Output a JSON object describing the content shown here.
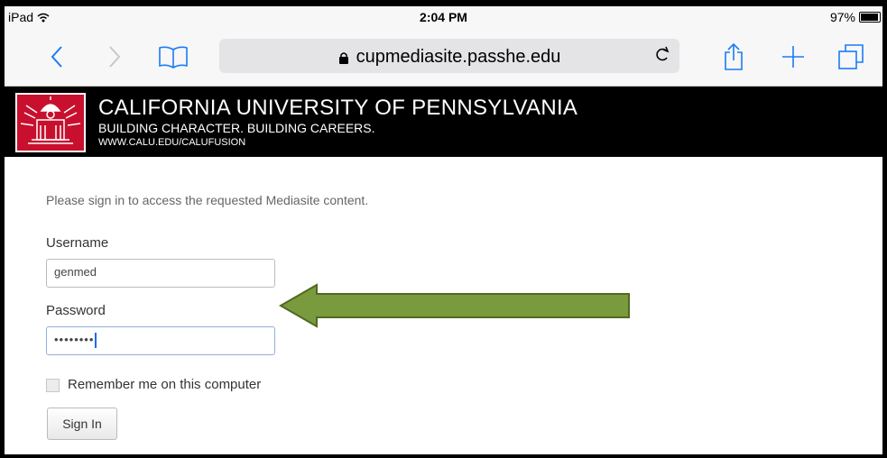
{
  "status_bar": {
    "device": "iPad",
    "time": "2:04 PM",
    "battery": "97%",
    "battery_level": 0.97
  },
  "browser": {
    "url": "cupmediasite.passhe.edu"
  },
  "banner": {
    "title": "CALIFORNIA UNIVERSITY OF PENNSYLVANIA",
    "subtitle": "BUILDING CHARACTER. BUILDING CAREERS.",
    "link": "WWW.CALU.EDU/CALUFUSION"
  },
  "form": {
    "message": "Please sign in to access the requested Mediasite content.",
    "username_label": "Username",
    "username_value": "genmed",
    "password_label": "Password",
    "password_value": "••••••••",
    "remember_label": "Remember me on this computer",
    "sign_in_label": "Sign In"
  },
  "colors": {
    "banner": "#000000",
    "logo": "#c8102e",
    "arrow": "#7a9a3e",
    "ios_blue": "#1a7cf5"
  }
}
